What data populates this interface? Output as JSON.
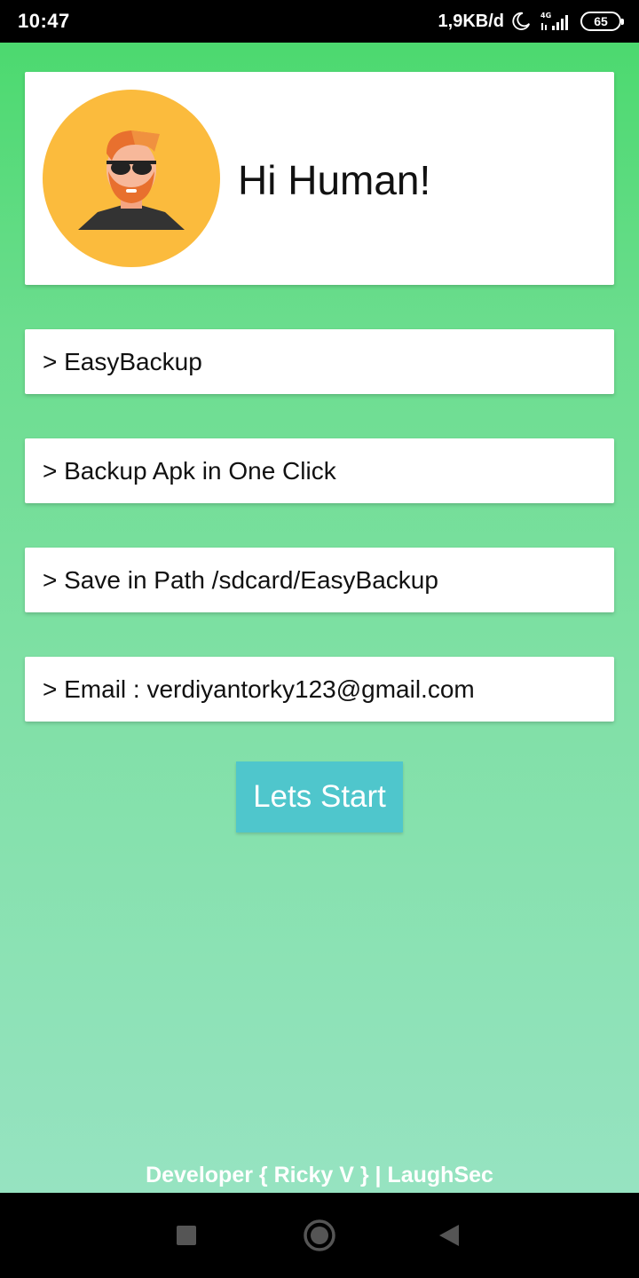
{
  "status_bar": {
    "time": "10:47",
    "speed": "1,9KB/d",
    "network": "4G",
    "battery": "65",
    "icons": [
      "moon-icon",
      "signal-icon",
      "battery-icon"
    ]
  },
  "profile": {
    "greeting": "Hi Human!",
    "avatar_icon": "hacker-avatar-icon",
    "avatar_bg": "#fbbb3d"
  },
  "info_items": [
    {
      "text": "> EasyBackup"
    },
    {
      "text": "> Backup Apk in One Click"
    },
    {
      "text": "> Save in Path /sdcard/EasyBackup"
    },
    {
      "text": "> Email : verdiyantorky123@gmail.com"
    }
  ],
  "start_button": {
    "label": "Lets Start",
    "color": "#4fc6cc"
  },
  "footer": {
    "text": "Developer { Ricky V } | LaughSec"
  },
  "nav_bar": {
    "icons": [
      "recent-apps-icon",
      "home-icon",
      "back-icon"
    ]
  },
  "colors": {
    "gradient_top": "#4cd96f",
    "gradient_bottom": "#96e3c1"
  }
}
